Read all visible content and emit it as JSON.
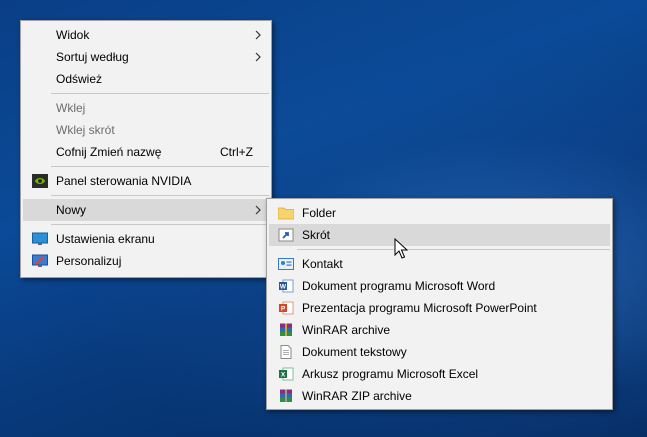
{
  "main_menu": {
    "items": [
      {
        "label": "Widok",
        "submenu": true
      },
      {
        "label": "Sortuj według",
        "submenu": true
      },
      {
        "label": "Odśwież"
      },
      {
        "label": "Wklej",
        "disabled": true
      },
      {
        "label": "Wklej skrót",
        "disabled": true
      },
      {
        "label": "Cofnij Zmień nazwę",
        "shortcut": "Ctrl+Z"
      },
      {
        "label": "Panel sterowania NVIDIA",
        "icon": "nvidia-icon"
      },
      {
        "label": "Nowy",
        "submenu": true,
        "highlighted": true
      },
      {
        "label": "Ustawienia ekranu",
        "icon": "display-settings-icon"
      },
      {
        "label": "Personalizuj",
        "icon": "personalize-icon"
      }
    ]
  },
  "sub_menu": {
    "items": [
      {
        "label": "Folder",
        "icon": "folder-icon"
      },
      {
        "label": "Skrót",
        "icon": "shortcut-icon",
        "highlighted": true
      },
      {
        "label": "Kontakt",
        "icon": "contact-card-icon"
      },
      {
        "label": "Dokument programu Microsoft Word",
        "icon": "word-document-icon"
      },
      {
        "label": "Prezentacja programu Microsoft PowerPoint",
        "icon": "powerpoint-icon"
      },
      {
        "label": "WinRAR archive",
        "icon": "winrar-icon"
      },
      {
        "label": "Dokument tekstowy",
        "icon": "text-document-icon"
      },
      {
        "label": "Arkusz programu Microsoft Excel",
        "icon": "excel-icon"
      },
      {
        "label": "WinRAR ZIP archive",
        "icon": "winrar-zip-icon"
      }
    ]
  },
  "colors": {
    "menu_bg": "#f2f2f2",
    "highlight": "#d9d9d9",
    "disabled_text": "#6d6d6d",
    "desktop_blue": "#0b4a98"
  }
}
